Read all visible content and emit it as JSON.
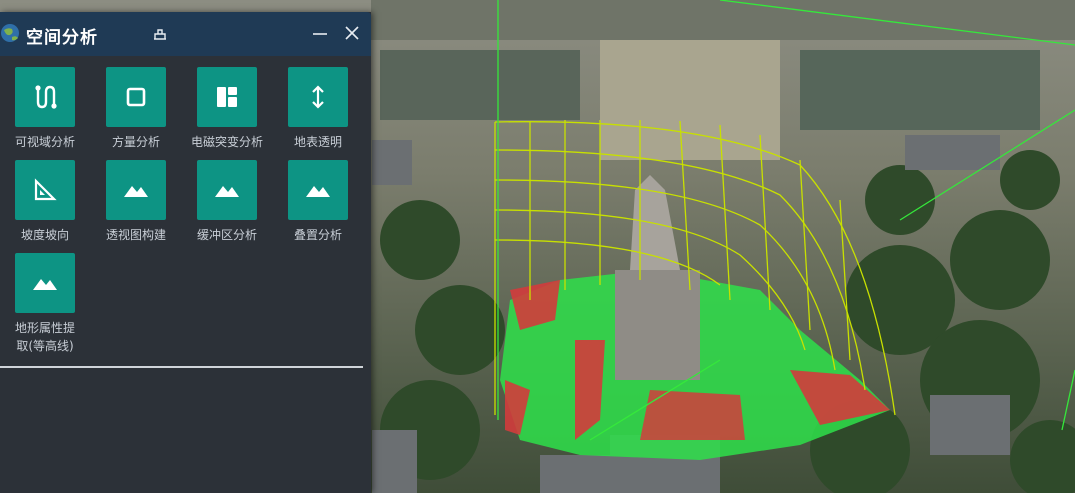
{
  "panel": {
    "title": "空间分析",
    "tools": [
      {
        "label": "可视域分析",
        "icon": "route-icon"
      },
      {
        "label": "方量分析",
        "icon": "square-icon"
      },
      {
        "label": "电磁突变分析",
        "icon": "layout-icon"
      },
      {
        "label": "地表透明",
        "icon": "vertical-arrows-icon"
      },
      {
        "label": "坡度坡向",
        "icon": "set-square-icon"
      },
      {
        "label": "透视图构建",
        "icon": "mountain-icon"
      },
      {
        "label": "缓冲区分析",
        "icon": "mountain-icon"
      },
      {
        "label": "叠置分析",
        "icon": "mountain-icon"
      },
      {
        "label": "地形属性提取(等高线)",
        "icon": "mountain-icon"
      }
    ]
  },
  "colors": {
    "header_bg": "#1f3a55",
    "panel_bg": "#2c3138",
    "tile_bg": "#0d9484",
    "visible_area": "#2ee04a",
    "hidden_area": "#d23c3c",
    "grid": "#c8e000"
  }
}
